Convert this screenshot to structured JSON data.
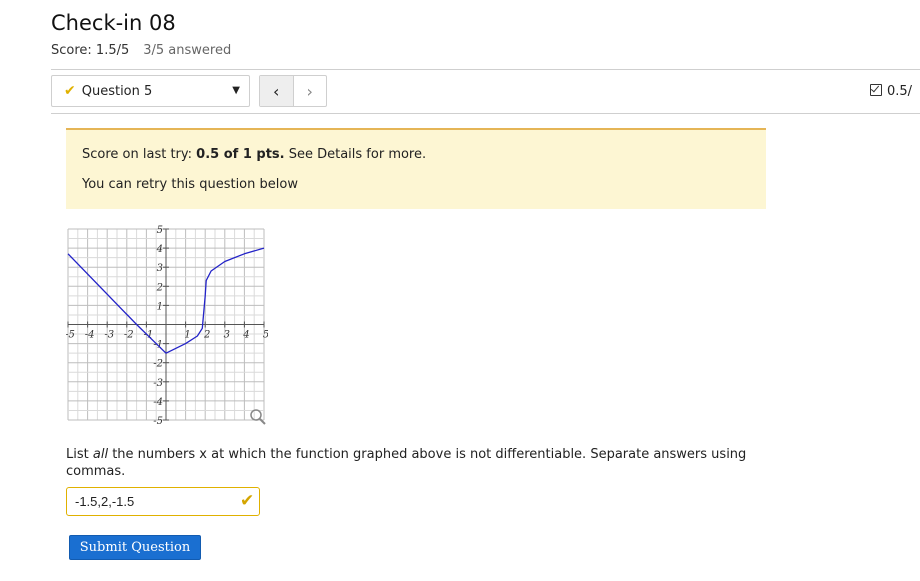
{
  "page": {
    "title": "Check-in 08"
  },
  "score": {
    "label": "Score: 1.5/5",
    "answered": "3/5 answered"
  },
  "question_nav": {
    "selected": "Question 5",
    "prev_icon": "chevron-left-icon",
    "next_icon": "chevron-right-icon"
  },
  "points": {
    "label": "0.5/"
  },
  "alert": {
    "prefix": "Score on last try: ",
    "score": "0.5 of 1 pts.",
    "suffix": " See Details for more.",
    "retry": "You can retry this question below"
  },
  "graph": {
    "x_ticks": [
      "-5",
      "-4",
      "-3",
      "-2",
      "-1",
      "1",
      "2",
      "3",
      "4",
      "5"
    ],
    "y_ticks": [
      "5",
      "4",
      "3",
      "2",
      "1",
      "-1",
      "-2",
      "-3",
      "-4",
      "-5"
    ],
    "zoom_icon": "magnifier-icon"
  },
  "chart_data": {
    "type": "line",
    "xlim": [
      -5,
      5
    ],
    "ylim": [
      -5,
      5
    ],
    "grid": true,
    "series": [
      {
        "x": [
          -5,
          -1.5,
          0,
          1,
          1.6,
          1.85,
          2,
          2.05,
          2.3,
          3,
          4,
          5
        ],
        "y": [
          3.7,
          0,
          -1.5,
          -1,
          -0.6,
          -0.2,
          1.5,
          2.3,
          2.8,
          3.3,
          3.7,
          4
        ]
      }
    ]
  },
  "question": {
    "text_before": "List ",
    "emphasis": "all",
    "text_after": " the numbers x at which the function graphed above is not differentiable. Separate answers using commas."
  },
  "answer": {
    "value": "-1.5,2,-1.5"
  },
  "submit": {
    "label": "Submit Question"
  },
  "colors": {
    "accent": "#1a6fd1",
    "alert_bg": "#fdf6d3",
    "alert_border": "#e5b556",
    "correct_partial": "#e0b100",
    "curve": "#2323c8"
  }
}
